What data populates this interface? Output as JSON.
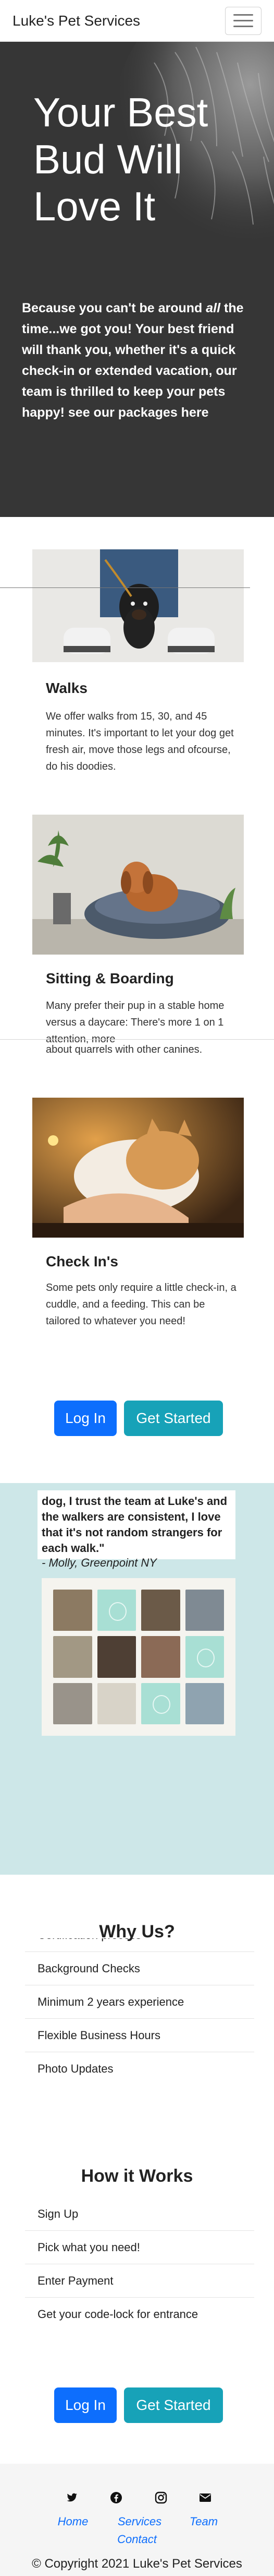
{
  "navbar": {
    "brand": "Luke's Pet Services",
    "menu_icon": "hamburger-menu-icon"
  },
  "hero": {
    "title": "Your Best Bud Will Love It",
    "intro_start": "Because you can't be around ",
    "intro_em": "all",
    "intro_end": " the time...we got you! Your best friend will thank you, whether it's a quick check-in or extended vacation, our team is thrilled to keep your pets happy! see our packages here"
  },
  "services": [
    {
      "title": "Walks",
      "text": "We offer walks from 15, 30, and 45 minutes. It's important to let your dog get fresh air, move those legs and ofcourse, do his doodies."
    },
    {
      "title": "Sitting & Boarding",
      "text_visible": "Many prefer their pup in a stable home versus a daycare: There's more 1 on 1 attention, more",
      "text_overlap": "about quarrels with other canines."
    },
    {
      "title": "Check In's",
      "text": "Some pets only require a little check-in, a cuddle, and a feeding. This can be tailored to whatever you need!"
    }
  ],
  "cta": {
    "login": "Log In",
    "get_started": "Get Started"
  },
  "testimonial": {
    "quote": "dog, I trust the team at Luke's and the walkers are consistent, I love that it's not random strangers for each walk.\"",
    "author": "- Molly, Greenpoint NY"
  },
  "why_us": {
    "title": "Why Us?",
    "items": [
      "Certification process",
      "Background Checks",
      "Minimum 2 years experience",
      "Flexible Business Hours",
      "Photo Updates"
    ]
  },
  "how_it_works": {
    "title": "How it Works",
    "items": [
      "Sign Up",
      "Pick what you need!",
      "Enter Payment",
      "Get your code-lock for entrance"
    ]
  },
  "footer": {
    "social_icons": [
      "twitter-icon",
      "facebook-icon",
      "instagram-icon",
      "email-icon"
    ],
    "links": [
      "Home",
      "Services",
      "Team",
      "Contact"
    ],
    "copyright": "© Copyright 2021 Luke's Pet Services"
  },
  "colors": {
    "primary": "#0d6efd",
    "teal": "#17a2b8",
    "hero_bg": "#363636",
    "testimonial_bg": "#cde7e8",
    "footer_bg": "#f5f5f5"
  }
}
